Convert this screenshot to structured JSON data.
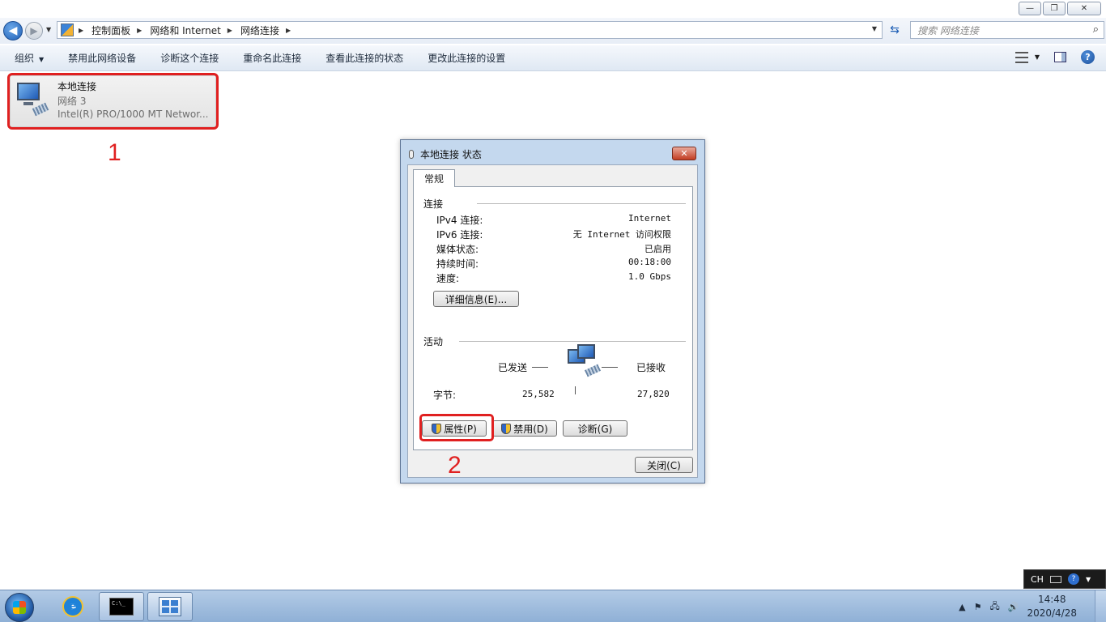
{
  "window": {
    "minimize": "—",
    "maximize": "❐",
    "close": "✕"
  },
  "address": {
    "crumbs": [
      "控制面板",
      "网络和 Internet",
      "网络连接"
    ],
    "search_placeholder": "搜索 网络连接"
  },
  "toolbar": {
    "organize": "组织",
    "items": [
      "禁用此网络设备",
      "诊断这个连接",
      "重命名此连接",
      "查看此连接的状态",
      "更改此连接的设置"
    ]
  },
  "connection": {
    "name": "本地连接",
    "network": "网络  3",
    "device": "Intel(R) PRO/1000 MT Networ..."
  },
  "annotations": {
    "step1": "1",
    "step2": "2"
  },
  "dialog": {
    "title": "本地连接 状态",
    "tab": "常规",
    "connection_group": "连接",
    "rows": [
      {
        "k": "IPv4 连接:",
        "v": "Internet"
      },
      {
        "k": "IPv6 连接:",
        "v": "无 Internet 访问权限"
      },
      {
        "k": "媒体状态:",
        "v": "已启用"
      },
      {
        "k": "持续时间:",
        "v": "00:18:00"
      },
      {
        "k": "速度:",
        "v": "1.0 Gbps"
      }
    ],
    "details_button": "详细信息(E)...",
    "activity_group": "活动",
    "sent_label": "已发送",
    "received_label": "已接收",
    "bytes_label": "字节:",
    "bytes_sent": "25,582",
    "bytes_received": "27,820",
    "properties_button": "属性(P)",
    "disable_button": "禁用(D)",
    "diagnose_button": "诊断(G)",
    "close_button": "关闭(C)"
  },
  "taskbar": {
    "time": "14:48",
    "date": "2020/4/28",
    "lang": "CH",
    "cmd_text": "C:\\_"
  }
}
